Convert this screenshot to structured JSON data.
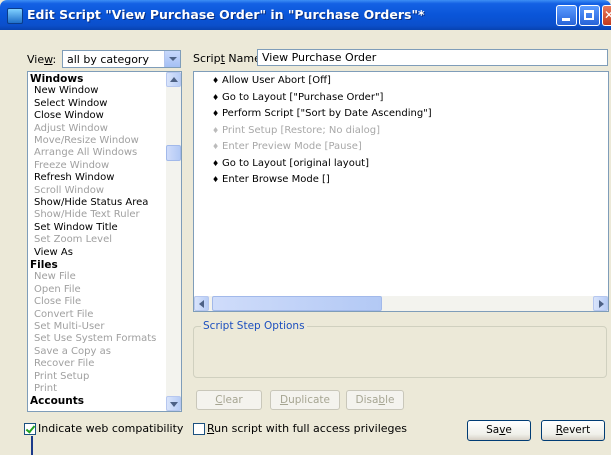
{
  "window": {
    "title": "Edit Script \"View Purchase Order\" in \"Purchase Orders\"*"
  },
  "view": {
    "label": "View:",
    "value": "all by category"
  },
  "script_name": {
    "label": "Script Name:",
    "value": "View Purchase Order"
  },
  "step_list": [
    {
      "label": "Windows",
      "type": "category"
    },
    {
      "label": "New Window",
      "type": "enabled"
    },
    {
      "label": "Select Window",
      "type": "enabled"
    },
    {
      "label": "Close Window",
      "type": "enabled"
    },
    {
      "label": "Adjust Window",
      "type": "disabled"
    },
    {
      "label": "Move/Resize Window",
      "type": "disabled"
    },
    {
      "label": "Arrange All Windows",
      "type": "disabled"
    },
    {
      "label": "Freeze Window",
      "type": "disabled"
    },
    {
      "label": "Refresh Window",
      "type": "enabled"
    },
    {
      "label": "Scroll Window",
      "type": "disabled"
    },
    {
      "label": "Show/Hide Status Area",
      "type": "enabled"
    },
    {
      "label": "Show/Hide Text Ruler",
      "type": "disabled"
    },
    {
      "label": "Set Window Title",
      "type": "enabled"
    },
    {
      "label": "Set Zoom Level",
      "type": "disabled"
    },
    {
      "label": "View As",
      "type": "enabled"
    },
    {
      "label": "Files",
      "type": "category"
    },
    {
      "label": "New File",
      "type": "disabled"
    },
    {
      "label": "Open File",
      "type": "disabled"
    },
    {
      "label": "Close File",
      "type": "disabled"
    },
    {
      "label": "Convert File",
      "type": "disabled"
    },
    {
      "label": "Set Multi-User",
      "type": "disabled"
    },
    {
      "label": "Set Use System Formats",
      "type": "disabled"
    },
    {
      "label": "Save a Copy as",
      "type": "disabled"
    },
    {
      "label": "Recover File",
      "type": "disabled"
    },
    {
      "label": "Print Setup",
      "type": "disabled"
    },
    {
      "label": "Print",
      "type": "disabled"
    },
    {
      "label": "Accounts",
      "type": "category"
    }
  ],
  "script_steps": [
    {
      "text": "Allow User Abort [Off]",
      "enabled": true
    },
    {
      "text": "Go to Layout [\"Purchase Order\"]",
      "enabled": true
    },
    {
      "text": "Perform Script [\"Sort by Date Ascending\"]",
      "enabled": true
    },
    {
      "text": "Print Setup [Restore; No dialog]",
      "enabled": false
    },
    {
      "text": "Enter Preview Mode [Pause]",
      "enabled": false
    },
    {
      "text": "Go to Layout [original layout]",
      "enabled": true
    },
    {
      "text": "Enter Browse Mode []",
      "enabled": true
    }
  ],
  "step_options": {
    "label": "Script Step Options"
  },
  "buttons": {
    "clear": "Clear",
    "duplicate": "Duplicate",
    "disable": "Disable",
    "save": "Save",
    "revert": "Revert"
  },
  "checkboxes": {
    "web_compat": {
      "label": "Indicate web compatibility",
      "checked": true
    },
    "full_access": {
      "label": "Run script with full access privileges",
      "checked": false
    }
  }
}
